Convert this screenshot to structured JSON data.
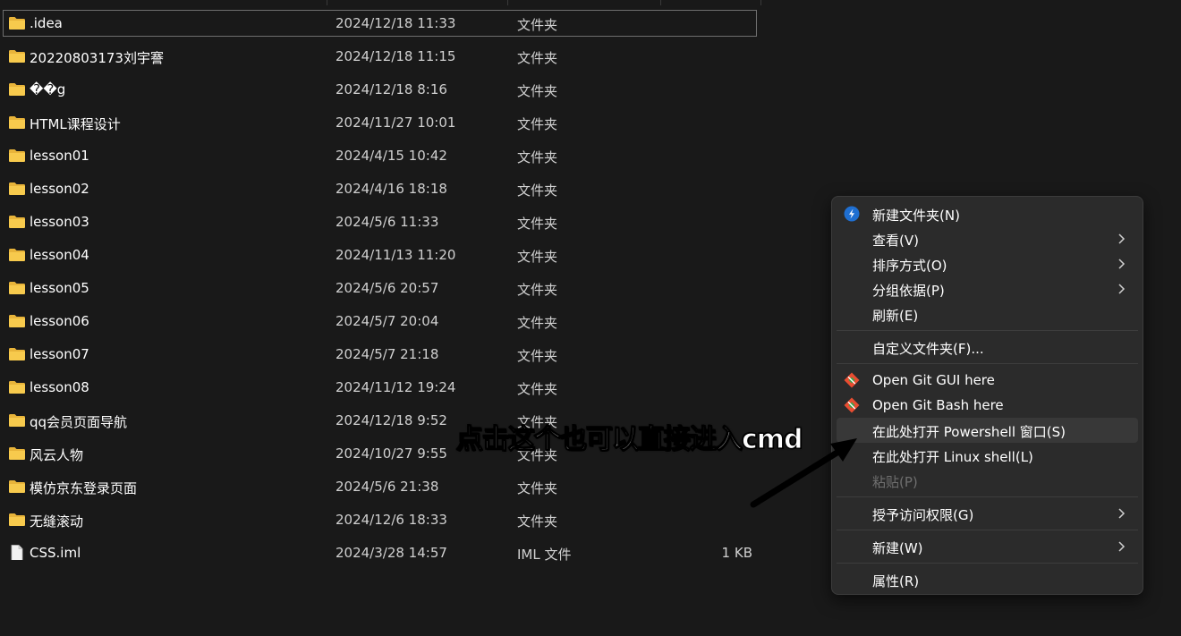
{
  "files": [
    {
      "name": ".idea",
      "date": "2024/12/18 11:33",
      "type": "文件夹",
      "size": "",
      "kind": "folder",
      "selected": true
    },
    {
      "name": "20220803173刘宇謇",
      "date": "2024/12/18 11:15",
      "type": "文件夹",
      "size": "",
      "kind": "folder"
    },
    {
      "name": "��g",
      "date": "2024/12/18 8:16",
      "type": "文件夹",
      "size": "",
      "kind": "folder"
    },
    {
      "name": "HTML课程设计",
      "date": "2024/11/27 10:01",
      "type": "文件夹",
      "size": "",
      "kind": "folder"
    },
    {
      "name": "lesson01",
      "date": "2024/4/15 10:42",
      "type": "文件夹",
      "size": "",
      "kind": "folder"
    },
    {
      "name": "lesson02",
      "date": "2024/4/16 18:18",
      "type": "文件夹",
      "size": "",
      "kind": "folder"
    },
    {
      "name": "lesson03",
      "date": "2024/5/6 11:33",
      "type": "文件夹",
      "size": "",
      "kind": "folder"
    },
    {
      "name": "lesson04",
      "date": "2024/11/13 11:20",
      "type": "文件夹",
      "size": "",
      "kind": "folder"
    },
    {
      "name": "lesson05",
      "date": "2024/5/6 20:57",
      "type": "文件夹",
      "size": "",
      "kind": "folder"
    },
    {
      "name": "lesson06",
      "date": "2024/5/7 20:04",
      "type": "文件夹",
      "size": "",
      "kind": "folder"
    },
    {
      "name": "lesson07",
      "date": "2024/5/7 21:18",
      "type": "文件夹",
      "size": "",
      "kind": "folder"
    },
    {
      "name": "lesson08",
      "date": "2024/11/12 19:24",
      "type": "文件夹",
      "size": "",
      "kind": "folder"
    },
    {
      "name": "qq会员页面导航",
      "date": "2024/12/18 9:52",
      "type": "文件夹",
      "size": "",
      "kind": "folder"
    },
    {
      "name": "风云人物",
      "date": "2024/10/27 9:55",
      "type": "文件夹",
      "size": "",
      "kind": "folder"
    },
    {
      "name": "模仿京东登录页面",
      "date": "2024/5/6 21:38",
      "type": "文件夹",
      "size": "",
      "kind": "folder"
    },
    {
      "name": "无缝滚动",
      "date": "2024/12/6 18:33",
      "type": "文件夹",
      "size": "",
      "kind": "folder"
    },
    {
      "name": "CSS.iml",
      "date": "2024/3/28 14:57",
      "type": "IML 文件",
      "size": "1 KB",
      "kind": "file"
    }
  ],
  "context_menu": {
    "items": [
      {
        "id": "new-folder",
        "label": "新建文件夹(N)",
        "icon": "new-folder-icon",
        "submenu": false
      },
      {
        "id": "view",
        "label": "查看(V)",
        "icon": "",
        "submenu": true
      },
      {
        "id": "sort-by",
        "label": "排序方式(O)",
        "icon": "",
        "submenu": true
      },
      {
        "id": "group-by",
        "label": "分组依据(P)",
        "icon": "",
        "submenu": true
      },
      {
        "id": "refresh",
        "label": "刷新(E)",
        "icon": "",
        "submenu": false
      },
      {
        "sep": true
      },
      {
        "id": "customize-folder",
        "label": "自定义文件夹(F)...",
        "icon": "",
        "submenu": false
      },
      {
        "sep": true
      },
      {
        "id": "git-gui",
        "label": "Open Git GUI here",
        "icon": "git-icon",
        "submenu": false
      },
      {
        "id": "git-bash",
        "label": "Open Git Bash here",
        "icon": "git-icon",
        "submenu": false
      },
      {
        "id": "powershell",
        "label": "在此处打开 Powershell 窗口(S)",
        "icon": "",
        "submenu": false,
        "hover": true
      },
      {
        "id": "linux-shell",
        "label": "在此处打开 Linux shell(L)",
        "icon": "",
        "submenu": false
      },
      {
        "id": "paste",
        "label": "粘贴(P)",
        "icon": "",
        "submenu": false,
        "disabled": true
      },
      {
        "sep": true
      },
      {
        "id": "grant-access",
        "label": "授予访问权限(G)",
        "icon": "",
        "submenu": true
      },
      {
        "sep": true
      },
      {
        "id": "new",
        "label": "新建(W)",
        "icon": "",
        "submenu": true
      },
      {
        "sep": true
      },
      {
        "id": "properties",
        "label": "属性(R)",
        "icon": "",
        "submenu": false
      }
    ]
  },
  "annotation": {
    "text": "点击这个也可以直接进入cmd"
  },
  "colors": {
    "background": "#191919",
    "folder": "#f4c542",
    "menu_bg": "#2b2b2b",
    "accent_blue": "#1f6fd1",
    "git_red": "#e84d31"
  }
}
